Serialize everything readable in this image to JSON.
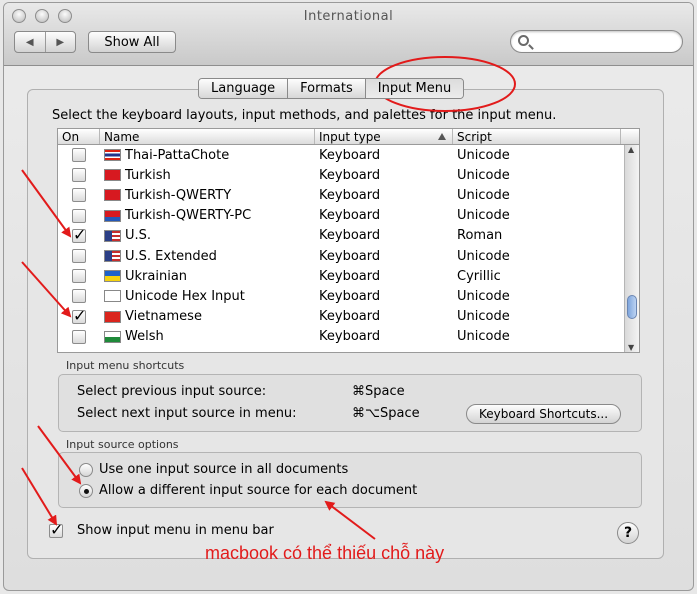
{
  "window": {
    "title": "International"
  },
  "toolbar": {
    "show_all_label": "Show All",
    "search_placeholder": ""
  },
  "tabs": [
    {
      "label": "Language",
      "active": false
    },
    {
      "label": "Formats",
      "active": false
    },
    {
      "label": "Input Menu",
      "active": true
    }
  ],
  "input_menu": {
    "instructions": "Select the keyboard layouts, input methods, and palettes for the input menu.",
    "columns": {
      "on": "On",
      "name": "Name",
      "type": "Input type",
      "script": "Script"
    },
    "rows": [
      {
        "checked": false,
        "name": "Thai-PattaChote",
        "type": "Keyboard",
        "script": "Unicode",
        "flag": "thai-flag"
      },
      {
        "checked": false,
        "name": "Turkish",
        "type": "Keyboard",
        "script": "Unicode",
        "flag": "turkish-flag"
      },
      {
        "checked": false,
        "name": "Turkish-QWERTY",
        "type": "Keyboard",
        "script": "Unicode",
        "flag": "turkish-flag"
      },
      {
        "checked": false,
        "name": "Turkish-QWERTY-PC",
        "type": "Keyboard",
        "script": "Unicode",
        "flag": "turkish-pc-flag"
      },
      {
        "checked": true,
        "name": "U.S.",
        "type": "Keyboard",
        "script": "Roman",
        "flag": "us-flag"
      },
      {
        "checked": false,
        "name": "U.S. Extended",
        "type": "Keyboard",
        "script": "Unicode",
        "flag": "us-flag"
      },
      {
        "checked": false,
        "name": "Ukrainian",
        "type": "Keyboard",
        "script": "Cyrillic",
        "flag": "ukraine-flag"
      },
      {
        "checked": false,
        "name": "Unicode Hex Input",
        "type": "Keyboard",
        "script": "Unicode",
        "flag": "unicode-icon"
      },
      {
        "checked": true,
        "name": "Vietnamese",
        "type": "Keyboard",
        "script": "Unicode",
        "flag": "vietnam-flag"
      },
      {
        "checked": false,
        "name": "Welsh",
        "type": "Keyboard",
        "script": "Unicode",
        "flag": "wales-flag"
      }
    ]
  },
  "shortcuts": {
    "label": "Input menu shortcuts",
    "prev_label": "Select previous input source:",
    "prev_key": "⌘Space",
    "next_label": "Select next input source in menu:",
    "next_key": "⌘⌥Space",
    "keyboard_shortcuts_button": "Keyboard Shortcuts..."
  },
  "source_options": {
    "label": "Input source options",
    "option1": "Use one input source in all documents",
    "option2": "Allow a different input source for each document",
    "selected": 2
  },
  "show_menu": {
    "label": "Show input menu in menu bar",
    "checked": true
  },
  "help_label": "?",
  "annotation": {
    "text": "macbook có thể thiếu chỗ này",
    "color": "#e21b1b"
  },
  "colors": {
    "annotation_red": "#e21b1b",
    "scroll_thumb": "#7fa6dd"
  }
}
